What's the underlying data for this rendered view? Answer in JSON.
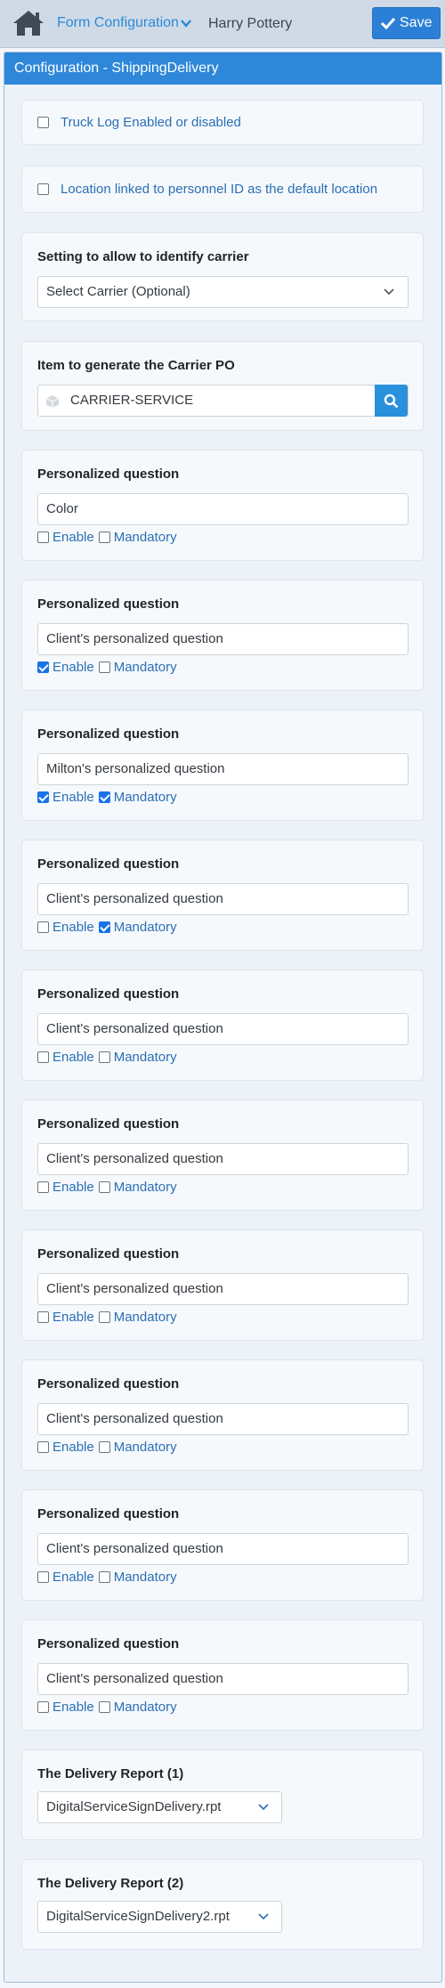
{
  "topbar": {
    "home_icon": "home-icon",
    "menu_label": "Form Configuration",
    "user_name": "Harry Pottery",
    "save_label": "Save"
  },
  "frame": {
    "header": "Configuration - ShippingDelivery"
  },
  "settings": {
    "truck_log": {
      "label": "Truck Log Enabled or disabled",
      "checked": false
    },
    "location_link": {
      "label": "Location linked to personnel ID as the default location",
      "checked": false
    }
  },
  "carrier": {
    "title": "Setting to allow to identify carrier",
    "selected": "Select Carrier (Optional)"
  },
  "carrier_po": {
    "title": "Item to generate the Carrier PO",
    "value": "CARRIER-SERVICE"
  },
  "questions": [
    {
      "title": "Personalized question",
      "value": "Color",
      "enable_label": "Enable",
      "mandatory_label": "Mandatory",
      "enable": false,
      "mandatory": false
    },
    {
      "title": "Personalized question",
      "value": "Client's personalized question",
      "enable_label": "Enable",
      "mandatory_label": "Mandatory",
      "enable": true,
      "mandatory": false
    },
    {
      "title": "Personalized question",
      "value": "Milton's personalized question",
      "enable_label": "Enable",
      "mandatory_label": "Mandatory",
      "enable": true,
      "mandatory": true
    },
    {
      "title": "Personalized question",
      "value": "Client's personalized question",
      "enable_label": "Enable",
      "mandatory_label": "Mandatory",
      "enable": false,
      "mandatory": true
    },
    {
      "title": "Personalized question",
      "value": "Client's personalized question",
      "enable_label": "Enable",
      "mandatory_label": "Mandatory",
      "enable": false,
      "mandatory": false
    },
    {
      "title": "Personalized question",
      "value": "Client's personalized question",
      "enable_label": "Enable",
      "mandatory_label": "Mandatory",
      "enable": false,
      "mandatory": false
    },
    {
      "title": "Personalized question",
      "value": "Client's personalized question",
      "enable_label": "Enable",
      "mandatory_label": "Mandatory",
      "enable": false,
      "mandatory": false
    },
    {
      "title": "Personalized question",
      "value": "Client's personalized question",
      "enable_label": "Enable",
      "mandatory_label": "Mandatory",
      "enable": false,
      "mandatory": false
    },
    {
      "title": "Personalized question",
      "value": "Client's personalized question",
      "enable_label": "Enable",
      "mandatory_label": "Mandatory",
      "enable": false,
      "mandatory": false
    },
    {
      "title": "Personalized question",
      "value": "Client's personalized question",
      "enable_label": "Enable",
      "mandatory_label": "Mandatory",
      "enable": false,
      "mandatory": false
    }
  ],
  "reports": [
    {
      "title": "The Delivery Report (1)",
      "selected": "DigitalServiceSignDelivery.rpt"
    },
    {
      "title": "The Delivery Report (2)",
      "selected": "DigitalServiceSignDelivery2.rpt"
    }
  ],
  "colors": {
    "accent": "#2e87d8",
    "link": "#2a6fb5",
    "topbar": "#cfdae6"
  }
}
